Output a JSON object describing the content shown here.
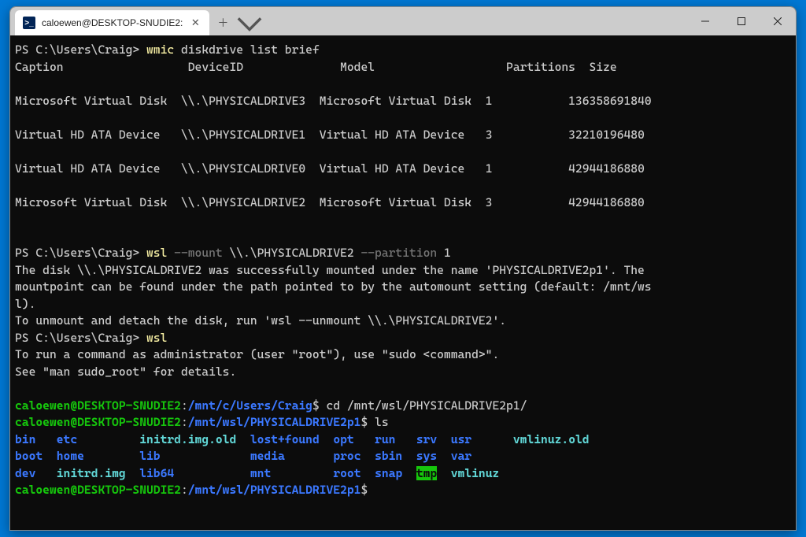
{
  "window": {
    "tab_title": "caloewen@DESKTOP-SNUDIE2:",
    "tab_icon_text": ">_"
  },
  "ps_prompt": "PS C:\\Users\\Craig> ",
  "cmd1": {
    "exe": "wmic",
    "args": " diskdrive list brief"
  },
  "table": {
    "headers": {
      "caption": "Caption",
      "deviceid": "DeviceID",
      "model": "Model",
      "partitions": "Partitions",
      "size": "Size"
    },
    "rows": [
      {
        "caption": "Microsoft Virtual Disk",
        "deviceid": "\\\\.\\PHYSICALDRIVE3",
        "model": "Microsoft Virtual Disk",
        "partitions": "1",
        "size": "136358691840"
      },
      {
        "caption": "Virtual HD ATA Device",
        "deviceid": "\\\\.\\PHYSICALDRIVE1",
        "model": "Virtual HD ATA Device",
        "partitions": "3",
        "size": "32210196480"
      },
      {
        "caption": "Virtual HD ATA Device",
        "deviceid": "\\\\.\\PHYSICALDRIVE0",
        "model": "Virtual HD ATA Device",
        "partitions": "1",
        "size": "42944186880"
      },
      {
        "caption": "Microsoft Virtual Disk",
        "deviceid": "\\\\.\\PHYSICALDRIVE2",
        "model": "Microsoft Virtual Disk",
        "partitions": "3",
        "size": "42944186880"
      }
    ]
  },
  "cmd2": {
    "exe": "wsl",
    "flag_mount": " --mount",
    "arg_drive": " \\\\.\\PHYSICALDRIVE2",
    "flag_part": " --partition",
    "arg_part": " 1"
  },
  "mount_output": {
    "line1": "The disk \\\\.\\PHYSICALDRIVE2 was successfully mounted under the name 'PHYSICALDRIVE2p1'. The",
    "line2": "mountpoint can be found under the path pointed to by the automount setting (default: /mnt/ws",
    "line3": "l).",
    "line4": "To unmount and detach the disk, run 'wsl --unmount \\\\.\\PHYSICALDRIVE2'."
  },
  "cmd3": {
    "exe": "wsl"
  },
  "sudo_notice": {
    "line1": "To run a command as administrator (user \"root\"), use \"sudo <command>\".",
    "line2": "See \"man sudo_root\" for details."
  },
  "wsl": {
    "user_host": "caloewen@DESKTOP-SNUDIE2",
    "colon": ":",
    "path1": "/mnt/c/Users/Craig",
    "path2": "/mnt/wsl/PHYSICALDRIVE2p1",
    "dollar": "$",
    "cmd_cd": " cd /mnt/wsl/PHYSICALDRIVE2p1/",
    "cmd_ls": " ls"
  },
  "ls": {
    "row1": {
      "c1": "bin",
      "c2": "etc",
      "c3": "initrd.img.old",
      "c4": "lost+found",
      "c5": "opt",
      "c6": "run",
      "c7": "srv",
      "c8": "usr",
      "c9": "vmlinuz.old"
    },
    "row2": {
      "c1": "boot",
      "c2": "home",
      "c3": "lib",
      "c4": "media",
      "c5": "proc",
      "c6": "sbin",
      "c7": "sys",
      "c8": "var"
    },
    "row3": {
      "c1": "dev",
      "c2": "initrd.img",
      "c3": "lib64",
      "c4": "mnt",
      "c5": "root",
      "c6": "snap",
      "c7": "tmp",
      "c8": "vmlinuz"
    }
  }
}
